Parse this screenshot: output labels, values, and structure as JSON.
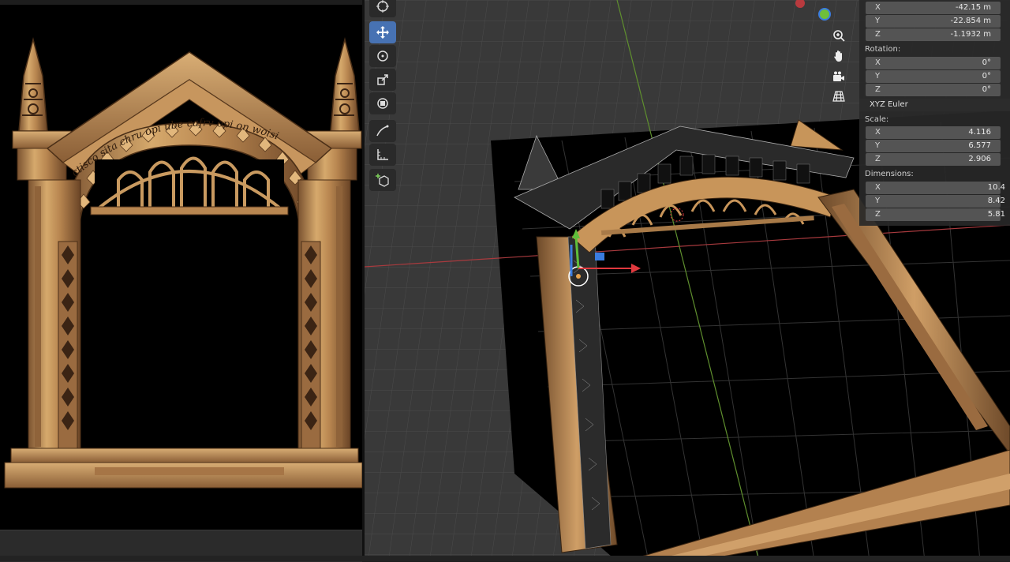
{
  "sidebar": {
    "location": {
      "x": {
        "axis": "X",
        "value": "-42.15 m"
      },
      "y": {
        "axis": "Y",
        "value": "-22.854 m"
      },
      "z": {
        "axis": "Z",
        "value": "-1.1932 m"
      }
    },
    "rotation": {
      "label": "Rotation:",
      "x": {
        "axis": "X",
        "value": "0°"
      },
      "y": {
        "axis": "Y",
        "value": "0°"
      },
      "z": {
        "axis": "Z",
        "value": "0°"
      },
      "mode": "XYZ Euler"
    },
    "scale": {
      "label": "Scale:",
      "x": {
        "axis": "X",
        "value": "4.116"
      },
      "y": {
        "axis": "Y",
        "value": "6.577"
      },
      "z": {
        "axis": "Z",
        "value": "2.906"
      }
    },
    "dimensions": {
      "label": "Dimensions:",
      "x": {
        "axis": "X",
        "value": "10.4"
      },
      "y": {
        "axis": "Y",
        "value": "8.42"
      },
      "z": {
        "axis": "Z",
        "value": "5.81"
      }
    }
  },
  "reference_image": {
    "inscription": "ctisco sita chru opi ube cafrv opi on woisi"
  },
  "toolbar": {
    "tools": [
      "cursor-icon",
      "move-icon",
      "rotate-icon",
      "scale-icon",
      "transform-icon",
      "annotate-icon",
      "measure-icon",
      "add-cube-icon"
    ],
    "active_tool": "move-icon"
  },
  "colors": {
    "active_tool": "#4772b3",
    "axis_x": "#e0393e",
    "axis_y": "#6fbf3a",
    "axis_z": "#3a7ce0",
    "frame_gold": "#c8955a"
  }
}
